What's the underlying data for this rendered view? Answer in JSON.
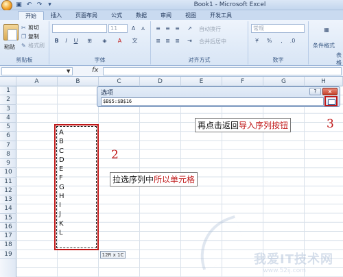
{
  "window": {
    "title": "Book1 - Microsoft Excel"
  },
  "ribbon": {
    "tabs": [
      "开始",
      "插入",
      "页面布局",
      "公式",
      "数据",
      "审阅",
      "视图",
      "开发工具"
    ],
    "clipboard": {
      "paste": "粘贴",
      "cut": "剪切",
      "copy": "复制",
      "format_painter": "格式刷",
      "label": "剪贴板"
    },
    "font": {
      "size": "11",
      "label": "字体"
    },
    "alignment": {
      "wrap_text": "自动换行",
      "merge_center": "合并后居中",
      "label": "对齐方式"
    },
    "number": {
      "format": "常规",
      "label": "数字"
    },
    "styles": {
      "conditional_format": "条件格式",
      "table_format": "表格"
    }
  },
  "formula_bar": {
    "fx": "fx"
  },
  "grid": {
    "columns": [
      "A",
      "B",
      "C",
      "D",
      "E",
      "F",
      "G",
      "H"
    ],
    "rows": [
      "1",
      "2",
      "3",
      "4",
      "5",
      "6",
      "7",
      "8",
      "9",
      "10",
      "11",
      "12",
      "13",
      "14",
      "15",
      "16",
      "17",
      "18",
      "19"
    ],
    "column_b_values": [
      "A",
      "B",
      "C",
      "D",
      "E",
      "F",
      "G",
      "H",
      "I",
      "J",
      "K",
      "L"
    ],
    "selection_tip": "12R x 1C"
  },
  "dialog": {
    "title": "选项",
    "help": "?",
    "close": "×",
    "range_value": "$B$5:$B$16"
  },
  "annotations": {
    "step2_number": "2",
    "step2_text": "拉选序列中",
    "step2_highlight": "所以单元格",
    "step3_number": "3",
    "step3_text": "再点击返回",
    "step3_highlight": "导入序列按钮"
  },
  "watermark": {
    "text": "我爱IT技术网",
    "url": "www.52ij.com"
  }
}
